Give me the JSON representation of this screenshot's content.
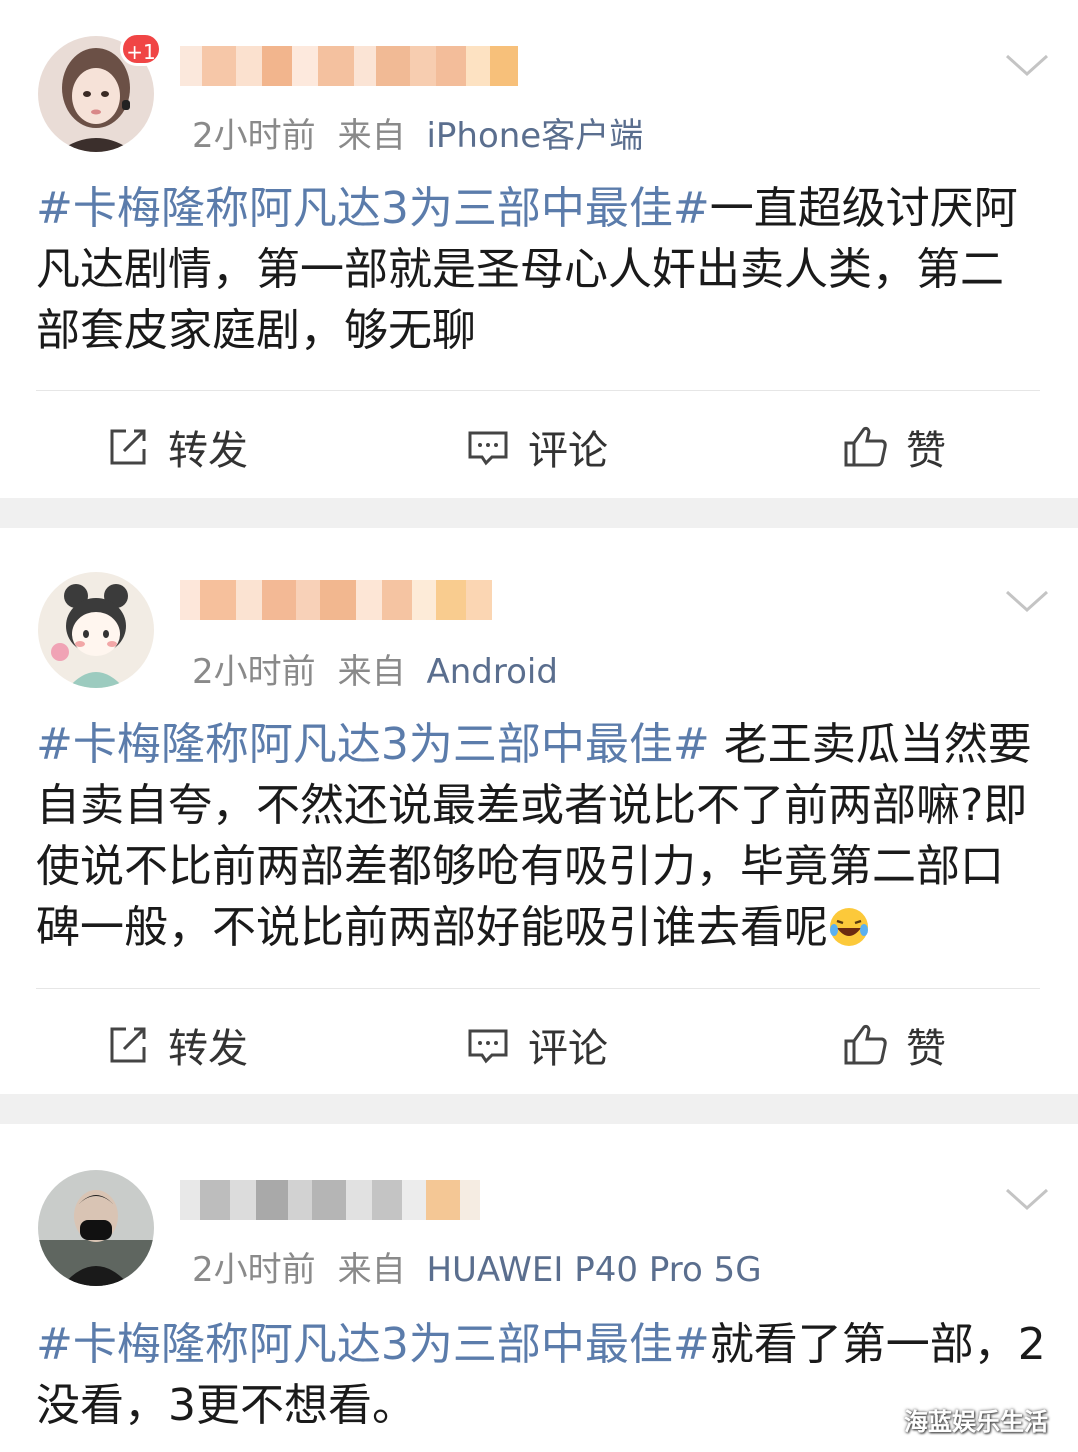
{
  "posts": [
    {
      "time": "2小时前",
      "from_label": "来自",
      "source": "iPhone客户端",
      "badge": "+1",
      "hashtag": "#卡梅隆称阿凡达3为三部中最佳#",
      "body": "一直超级讨厌阿凡达剧情，第一部就是圣母心人奸出卖人类，第二部套皮家庭剧，够无聊",
      "actions": {
        "repost": "转发",
        "comment": "评论",
        "like": "赞"
      }
    },
    {
      "time": "2小时前",
      "from_label": "来自",
      "source": "Android",
      "hashtag": "#卡梅隆称阿凡达3为三部中最佳#",
      "body": " 老王卖瓜当然要自卖自夸，不然还说最差或者说比不了前两部嘛?即使说不比前两部差都够呛有吸引力，毕竟第二部口碑一般，不说比前两部好能吸引谁去看呢",
      "emoji": "laughing-crying-emoji",
      "actions": {
        "repost": "转发",
        "comment": "评论",
        "like": "赞"
      }
    },
    {
      "time": "2小时前",
      "from_label": "来自",
      "source": "HUAWEI P40 Pro 5G",
      "hashtag": "#卡梅隆称阿凡达3为三部中最佳#",
      "body": "就看了第一部，2没看，3更不想看。"
    }
  ],
  "watermark": "海蓝娱乐生活",
  "colors": {
    "hashtag": "#5b7cab",
    "source": "#5a6e8e",
    "meta": "#8a8a8a",
    "separator": "#f0f0f0",
    "badge": "#f04545"
  },
  "icons": [
    "repost-icon",
    "comment-icon",
    "like-icon",
    "chevron-down-icon"
  ]
}
